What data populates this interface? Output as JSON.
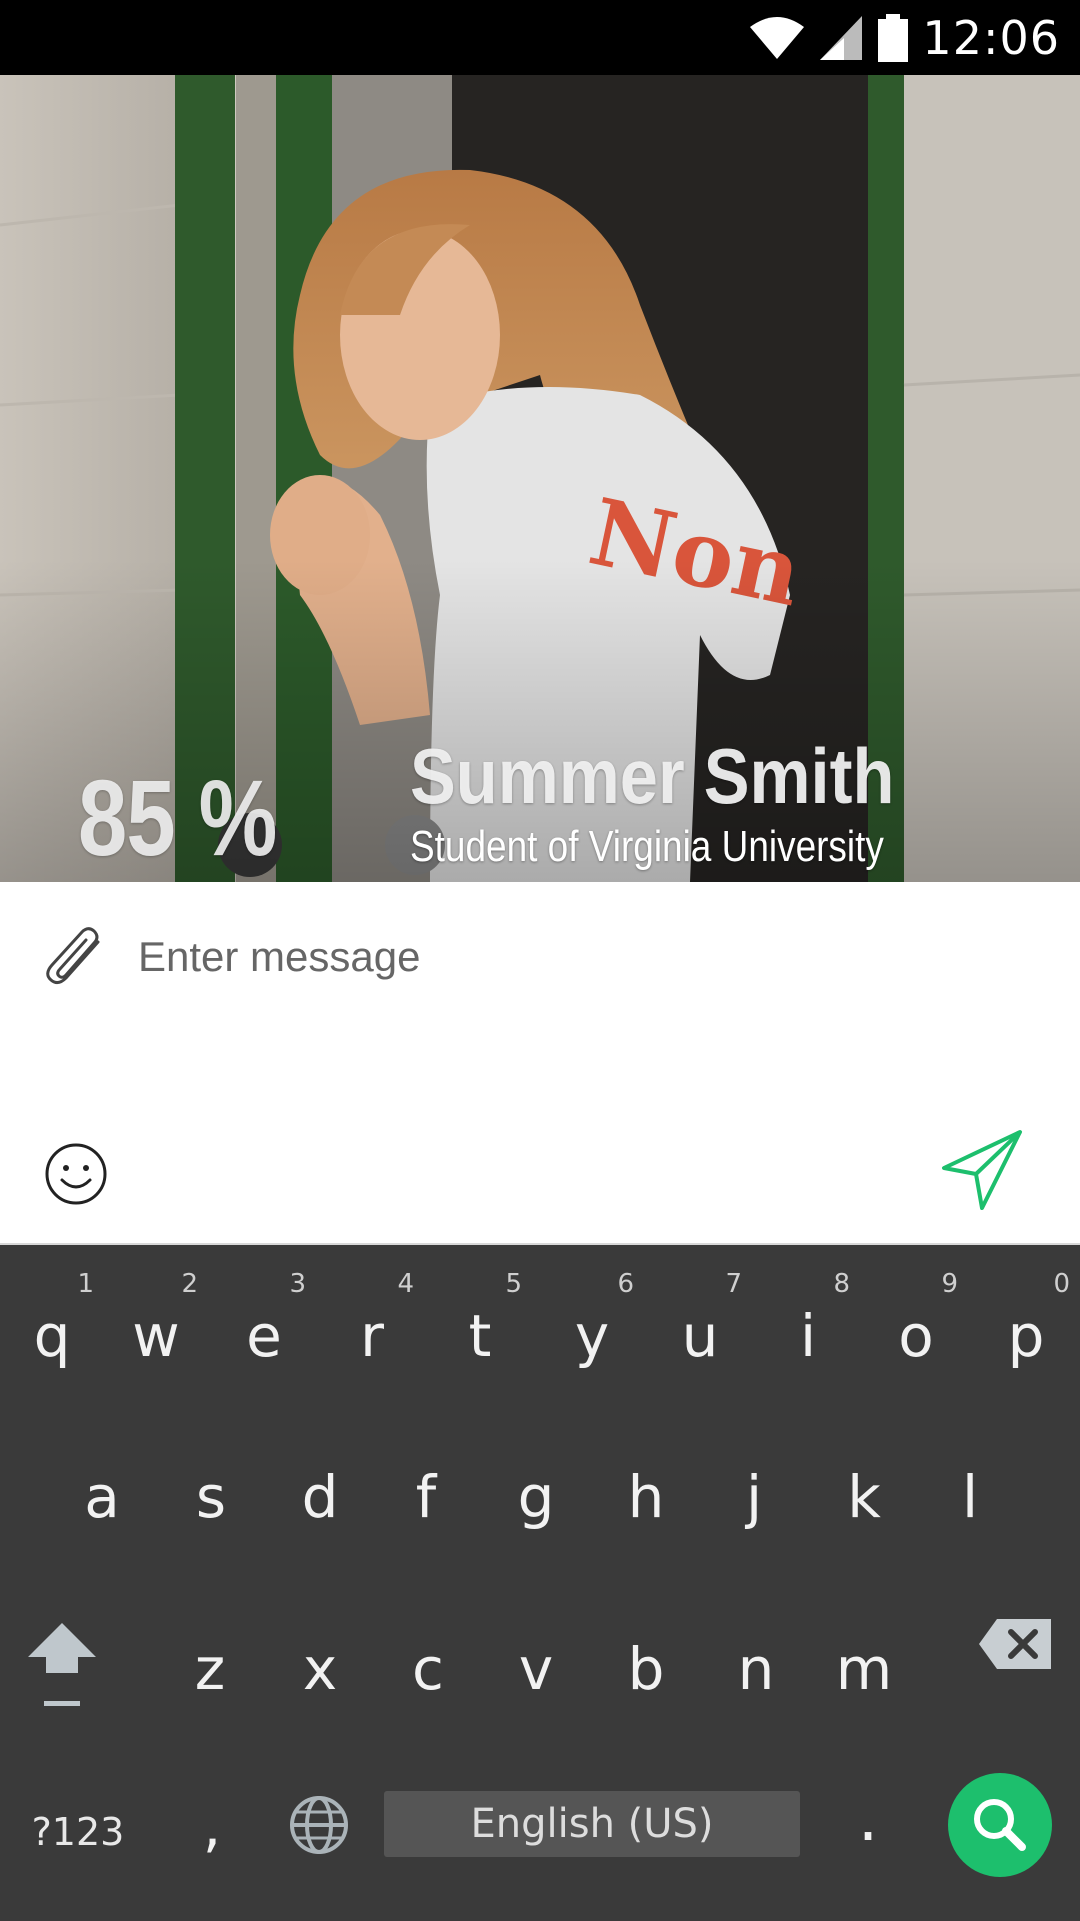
{
  "status_bar": {
    "time": "12:06",
    "icons": [
      "wifi-icon",
      "cell-signal-icon",
      "battery-icon"
    ]
  },
  "profile": {
    "match_percent": "85 %",
    "name": "Summer Smith",
    "subtitle": "Student of Virginia University"
  },
  "composer": {
    "placeholder": "Enter message",
    "icons": [
      "paperclip-icon",
      "emoji-icon",
      "send-icon"
    ],
    "accent_color": "#1dbf6d"
  },
  "keyboard": {
    "row1": [
      {
        "ch": "q",
        "num": "1"
      },
      {
        "ch": "w",
        "num": "2"
      },
      {
        "ch": "e",
        "num": "3"
      },
      {
        "ch": "r",
        "num": "4"
      },
      {
        "ch": "t",
        "num": "5"
      },
      {
        "ch": "y",
        "num": "6"
      },
      {
        "ch": "u",
        "num": "7"
      },
      {
        "ch": "i",
        "num": "8"
      },
      {
        "ch": "o",
        "num": "9"
      },
      {
        "ch": "p",
        "num": "0"
      }
    ],
    "row2": [
      "a",
      "s",
      "d",
      "f",
      "g",
      "h",
      "j",
      "k",
      "l"
    ],
    "row3": [
      "z",
      "x",
      "c",
      "v",
      "b",
      "n",
      "m"
    ],
    "symbols_label": "?123",
    "comma": ",",
    "period": ".",
    "space_label": "English (US)",
    "background": "#3a3a3a"
  }
}
